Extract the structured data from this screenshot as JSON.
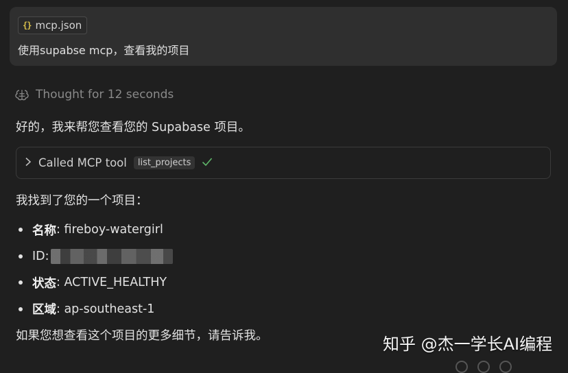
{
  "user_message": {
    "attachment_name": "mcp.json",
    "attachment_icon": "json-file-icon",
    "text": "使用supabse mcp，查看我的项目"
  },
  "thought": {
    "icon": "brain-icon",
    "label": "Thought for 12 seconds"
  },
  "assistant": {
    "intro": "好的，我来帮您查看您的 Supabase 项目。",
    "tool_call": {
      "label": "Called MCP tool",
      "tool_name": "list_projects",
      "status_icon": "checkmark-icon"
    },
    "found_line": "我找到了您的一个项目：",
    "items": [
      {
        "key": "名称",
        "value": ": fireboy-watergirl"
      },
      {
        "key": "ID",
        "value": ":"
      },
      {
        "key": "状态",
        "value": ": ACTIVE_HEALTHY"
      },
      {
        "key": "区域",
        "value": ": ap-southeast-1"
      }
    ],
    "closing": "如果您想查看这个项目的更多细节，请告诉我。"
  },
  "watermark": "知乎 @杰一学长AI编程",
  "colors": {
    "background": "#1f1f1f",
    "bubble": "#2f2f2f",
    "json_icon": "#d9c04a",
    "success": "#5fb86a"
  }
}
